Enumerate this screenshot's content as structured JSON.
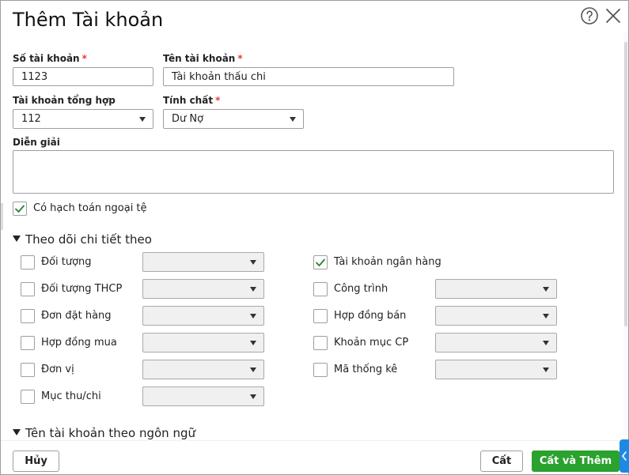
{
  "dialog": {
    "title": "Thêm Tài khoản"
  },
  "form": {
    "account_number": {
      "label": "Số tài khoản",
      "required_mark": "*",
      "value": "1123"
    },
    "account_name": {
      "label": "Tên tài khoản",
      "required_mark": "*",
      "value": "Tài khoản thấu chi"
    },
    "parent_account": {
      "label": "Tài khoản tổng hợp",
      "value": "112"
    },
    "nature": {
      "label": "Tính chất",
      "required_mark": "*",
      "value": "Dư Nợ"
    },
    "description": {
      "label": "Diễn giải",
      "value": ""
    },
    "foreign_currency": {
      "label": "Có hạch toán ngoại tệ",
      "checked": true
    }
  },
  "tracking": {
    "title": "Theo dõi chi tiết theo",
    "left": [
      {
        "label": "Đối tượng",
        "checked": false,
        "value": ""
      },
      {
        "label": "Đối tượng THCP",
        "checked": false,
        "value": ""
      },
      {
        "label": "Đơn đặt hàng",
        "checked": false,
        "value": ""
      },
      {
        "label": "Hợp đồng mua",
        "checked": false,
        "value": ""
      },
      {
        "label": "Đơn vị",
        "checked": false,
        "value": ""
      },
      {
        "label": "Mục thu/chi",
        "checked": false,
        "value": ""
      }
    ],
    "right": [
      {
        "label": "Tài khoản ngân hàng",
        "checked": true
      },
      {
        "label": "Công trình",
        "checked": false,
        "value": ""
      },
      {
        "label": "Hợp đồng bán",
        "checked": false,
        "value": ""
      },
      {
        "label": "Khoản mục CP",
        "checked": false,
        "value": ""
      },
      {
        "label": "Mã thống kê",
        "checked": false,
        "value": ""
      }
    ]
  },
  "language_section": {
    "title": "Tên tài khoản theo ngôn ngữ"
  },
  "footer": {
    "cancel_label": "Hủy",
    "save_label": "Cất",
    "save_add_label": "Cất và Thêm"
  },
  "colors": {
    "primary": "#2aa22e",
    "required": "#e53935",
    "check": "#2e7d32",
    "side_tab": "#1e88e5"
  }
}
